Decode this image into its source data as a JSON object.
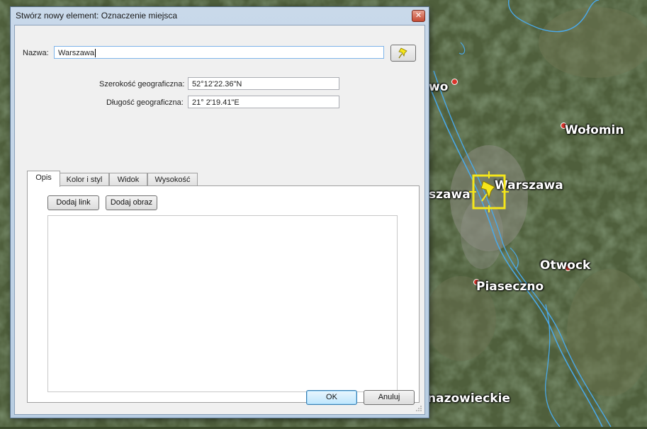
{
  "dialog": {
    "title": "Stwórz nowy element: Oznaczenie miejsca",
    "close_symbol": "✕",
    "name_label": "Nazwa:",
    "name_value": "Warszawa",
    "lat_label": "Szerokość geograficzna:",
    "lat_value": "52°12'22.36\"N",
    "lon_label": "Długość geograficzna:",
    "lon_value": "21° 2'19.41\"E",
    "pin_icon": "yellow-pushpin-icon",
    "tabs": [
      {
        "label": "Opis",
        "active": true
      },
      {
        "label": "Kolor i styl",
        "active": false
      },
      {
        "label": "Widok",
        "active": false
      },
      {
        "label": "Wysokość",
        "active": false
      }
    ],
    "add_link_label": "Dodaj link",
    "add_image_label": "Dodaj obraz",
    "description_value": "",
    "ok_label": "OK",
    "cancel_label": "Anuluj"
  },
  "map": {
    "labels": [
      "wo",
      "Wołomin",
      "szawa",
      "Warszawa",
      "Otwock",
      "Piaseczno",
      "nazowieckie"
    ],
    "pin_color": "#f5e61a",
    "river_color": "#4aa8e8"
  }
}
